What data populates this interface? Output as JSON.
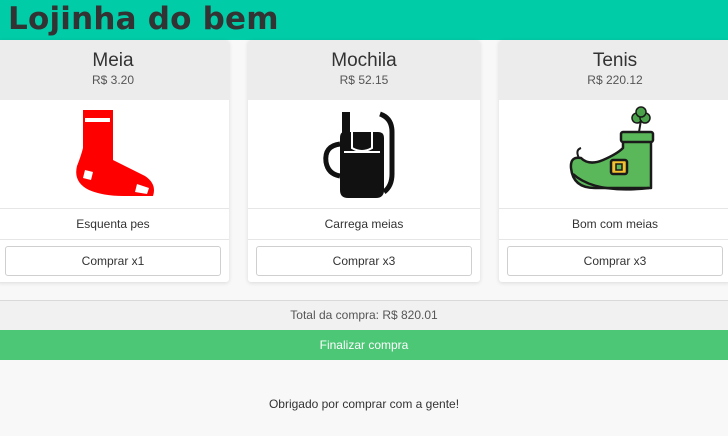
{
  "header": {
    "title": "Lojinha do bem"
  },
  "products": [
    {
      "name": "Meia",
      "price": "R$ 3.20",
      "icon": "sock-icon",
      "description": "Esquenta pes",
      "button_label": "Comprar x1"
    },
    {
      "name": "Mochila",
      "price": "R$ 52.15",
      "icon": "backpack-icon",
      "description": "Carrega meias",
      "button_label": "Comprar x3"
    },
    {
      "name": "Tenis",
      "price": "R$ 220.12",
      "icon": "leprechaun-shoe-icon",
      "description": "Bom com meias",
      "button_label": "Comprar x3"
    }
  ],
  "cart": {
    "total_text": "Total da compra: R$ 820.01",
    "finish_label": "Finalizar compra"
  },
  "footer": {
    "thanks": "Obrigado por comprar com a gente!"
  },
  "colors": {
    "header": "#00cca8",
    "finish_button": "#4bc775",
    "sock": "#ff0000",
    "shoe": "#5bb85a"
  }
}
